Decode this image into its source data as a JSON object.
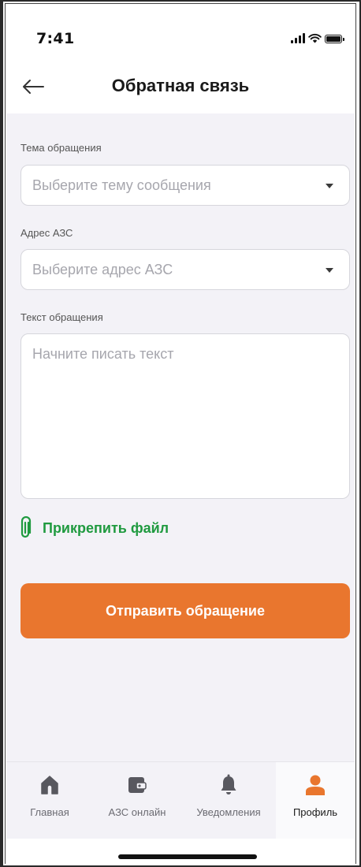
{
  "status_bar": {
    "time": "7:41"
  },
  "header": {
    "title": "Обратная связь"
  },
  "form": {
    "topic": {
      "label": "Тема обращения",
      "placeholder": "Выберите тему сообщения"
    },
    "address": {
      "label": "Адрес АЗС",
      "placeholder": "Выберите адрес АЗС"
    },
    "text": {
      "label": "Текст обращения",
      "placeholder": "Начните писать текст"
    },
    "attach_label": "Прикрепить файл",
    "submit_label": "Отправить обращение"
  },
  "tabbar": {
    "items": [
      {
        "label": "Главная",
        "icon": "home-icon"
      },
      {
        "label": "АЗС онлайн",
        "icon": "wallet-icon"
      },
      {
        "label": "Уведомления",
        "icon": "bell-icon"
      },
      {
        "label": "Профиль",
        "icon": "profile-icon"
      }
    ],
    "active_index": 3
  },
  "colors": {
    "accent_orange": "#e9762e",
    "accent_green": "#1f9a3f",
    "inactive_icon": "#58585f",
    "background": "#f3f2f7"
  }
}
